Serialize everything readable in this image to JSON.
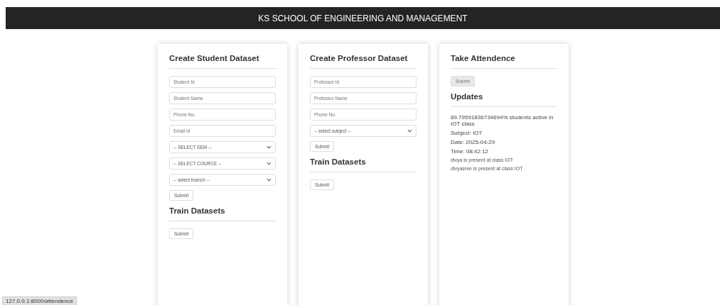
{
  "header": {
    "title": "KS SCHOOL OF ENGINEERING AND MANAGEMENT"
  },
  "cards": [
    {
      "sections": [
        {
          "title": "Create Student Dataset",
          "fields": [
            {
              "kind": "input",
              "placeholder": "Student Id"
            },
            {
              "kind": "input",
              "placeholder": "Student Name"
            },
            {
              "kind": "input",
              "placeholder": "Phone No."
            },
            {
              "kind": "input",
              "placeholder": "Email Id"
            },
            {
              "kind": "select",
              "value": "-- SELECT SEM --"
            },
            {
              "kind": "select",
              "value": "-- SELECT COURCE --"
            },
            {
              "kind": "select",
              "value": "-- select branch --"
            }
          ],
          "button": {
            "label": "Submit",
            "disabled": false
          }
        },
        {
          "title": "Train Datasets",
          "button": {
            "label": "Submit",
            "disabled": false
          }
        }
      ]
    },
    {
      "sections": [
        {
          "title": "Create Professor Dataset",
          "fields": [
            {
              "kind": "input",
              "placeholder": "Professor Id"
            },
            {
              "kind": "input",
              "placeholder": "Professor Name"
            },
            {
              "kind": "input",
              "placeholder": "Phone No."
            },
            {
              "kind": "select",
              "value": "-- select subject --"
            }
          ],
          "button": {
            "label": "Submit",
            "disabled": false
          }
        },
        {
          "title": "Train Datasets",
          "button": {
            "label": "Submit",
            "disabled": false
          }
        }
      ]
    },
    {
      "sections": [
        {
          "title": "Take Attendence",
          "button": {
            "label": "Submit",
            "disabled": true
          }
        },
        {
          "title": "Updates",
          "updates": [
            {
              "kind": "large",
              "text": "89.79591836734694% students active in IOT class"
            },
            {
              "kind": "large",
              "text": "Subject: IOT"
            },
            {
              "kind": "large",
              "text": "Date: 2025-04-29"
            },
            {
              "kind": "large",
              "text": "Time: 08:42:12"
            },
            {
              "kind": "small",
              "text": "divya is present at class IOT"
            },
            {
              "kind": "small",
              "text": "divyasree is present at class IOT"
            }
          ]
        }
      ]
    }
  ],
  "status_bar": {
    "url": "127.0.0.1:8000/attendence"
  }
}
